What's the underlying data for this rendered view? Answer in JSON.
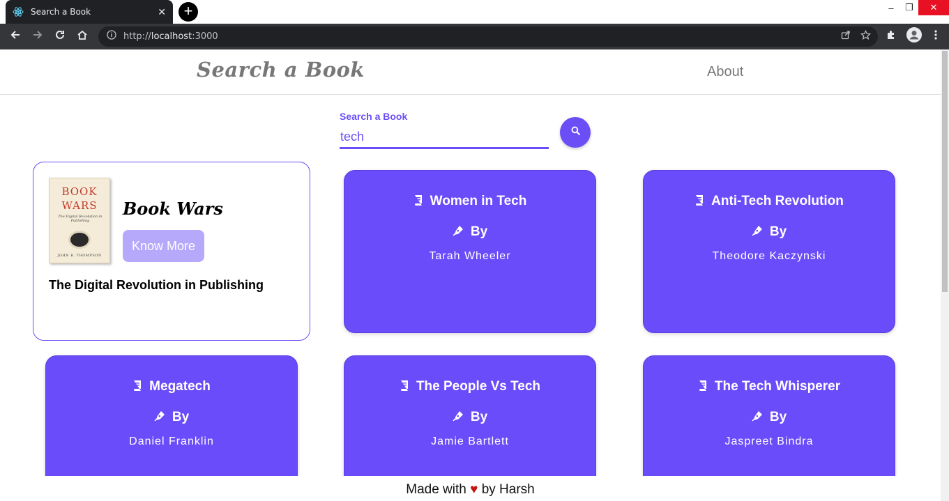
{
  "browser": {
    "tab_title": "Search a Book",
    "url_prefix": "http://",
    "url_host": "localhost",
    "url_port": ":3000",
    "new_tab_label": "+",
    "tab_close_label": "✕",
    "minimize_label": "–",
    "restore_label": "❐",
    "close_label": "✕"
  },
  "navbar": {
    "brand": "Search a Book",
    "about": "About"
  },
  "search": {
    "label": "Search a Book",
    "value": "tech"
  },
  "featured": {
    "title": "Book Wars",
    "subtitle": "The Digital Revolution in Publishing",
    "button": "Know More",
    "cover_line1": "BOOK",
    "cover_line2": "WARS",
    "cover_sub": "The Digital Revolution in Publishing",
    "cover_author": "JOHN B. THOMPSON"
  },
  "by_label": "By",
  "books": [
    {
      "title": "Women in Tech",
      "author": "Tarah Wheeler"
    },
    {
      "title": "Anti-Tech Revolution",
      "author": "Theodore Kaczynski"
    },
    {
      "title": "Megatech",
      "author": "Daniel Franklin"
    },
    {
      "title": "The People Vs Tech",
      "author": "Jamie Bartlett"
    },
    {
      "title": "The Tech Whisperer",
      "author": "Jaspreet Bindra"
    }
  ],
  "footer": {
    "before": "Made with",
    "heart": "♥",
    "after": "by Harsh"
  },
  "colors": {
    "accent": "#6c4ef7",
    "card": "#6a4cfa",
    "button_light": "#b6a9fb",
    "heart": "#c0170f"
  }
}
